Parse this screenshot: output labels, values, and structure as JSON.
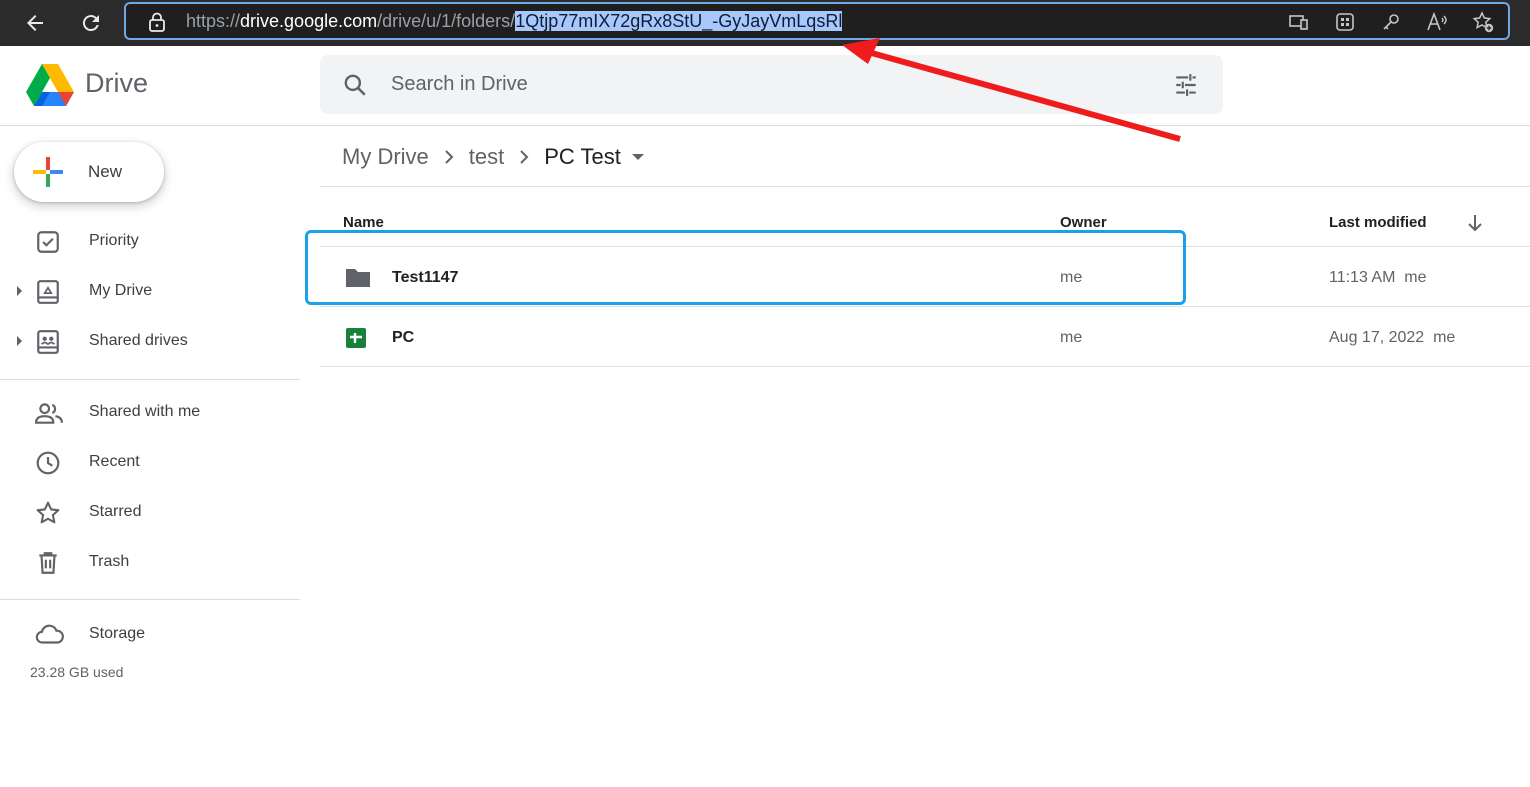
{
  "browser": {
    "url_prefix": "https://",
    "url_host": "drive.google.com",
    "url_path": "/drive/u/1/folders/",
    "url_selected": "1Qtjp77mIX72gRx8StU_-GyJayVmLqsRl"
  },
  "header": {
    "app_name": "Drive",
    "search_placeholder": "Search in Drive"
  },
  "sidebar": {
    "new_label": "New",
    "items": [
      {
        "label": "Priority",
        "icon": "priority-icon"
      },
      {
        "label": "My Drive",
        "icon": "my-drive-icon"
      },
      {
        "label": "Shared drives",
        "icon": "shared-drives-icon"
      },
      {
        "label": "Shared with me",
        "icon": "people-icon"
      },
      {
        "label": "Recent",
        "icon": "clock-icon"
      },
      {
        "label": "Starred",
        "icon": "star-icon"
      },
      {
        "label": "Trash",
        "icon": "trash-icon"
      },
      {
        "label": "Storage",
        "icon": "cloud-icon"
      }
    ],
    "storage_used": "23.28 GB used"
  },
  "breadcrumb": [
    "My Drive",
    "test",
    "PC Test"
  ],
  "table": {
    "headers": {
      "name": "Name",
      "owner": "Owner",
      "modified": "Last modified"
    },
    "rows": [
      {
        "name": "Test1147",
        "owner": "me",
        "modified": "11:13 AM  me",
        "type": "folder"
      },
      {
        "name": "PC",
        "owner": "me",
        "modified": "Aug 17, 2022  me",
        "type": "sheet"
      }
    ]
  },
  "colors": {
    "highlight": "#1da1e6",
    "arrow": "#ee1c1c",
    "sheets_green": "#188038"
  }
}
